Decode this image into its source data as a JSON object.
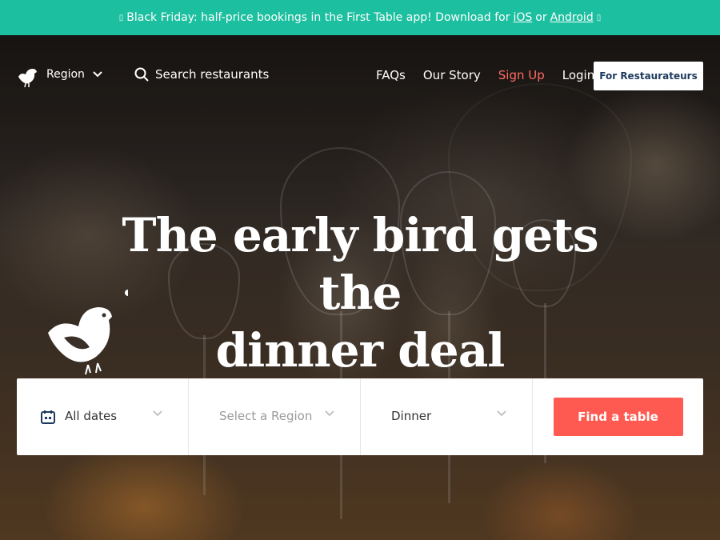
{
  "promo": {
    "text_before": "Black Friday: half-price bookings in the First Table app! Download for",
    "ios_label": "iOS",
    "or_text": "or",
    "android_label": "Android",
    "bg_color": "#1cbf9f"
  },
  "nav": {
    "logo_icon": "bird-icon",
    "region_label": "Region",
    "search_placeholder": "Search restaurants",
    "links": [
      {
        "label": "FAQs"
      },
      {
        "label": "Our Story"
      },
      {
        "label": "Sign Up"
      },
      {
        "label": "Login"
      }
    ],
    "for_restaurateurs_label": "For Restaurateurs",
    "accent_color": "#ff6b63"
  },
  "hero": {
    "headline_line1": "The early bird gets the",
    "headline_line2": "dinner deal"
  },
  "search_bar": {
    "date_value": "All dates",
    "region_placeholder": "Select a Region",
    "meal_value": "Dinner",
    "find_button_label": "Find a table",
    "button_color": "#ff5a52"
  }
}
